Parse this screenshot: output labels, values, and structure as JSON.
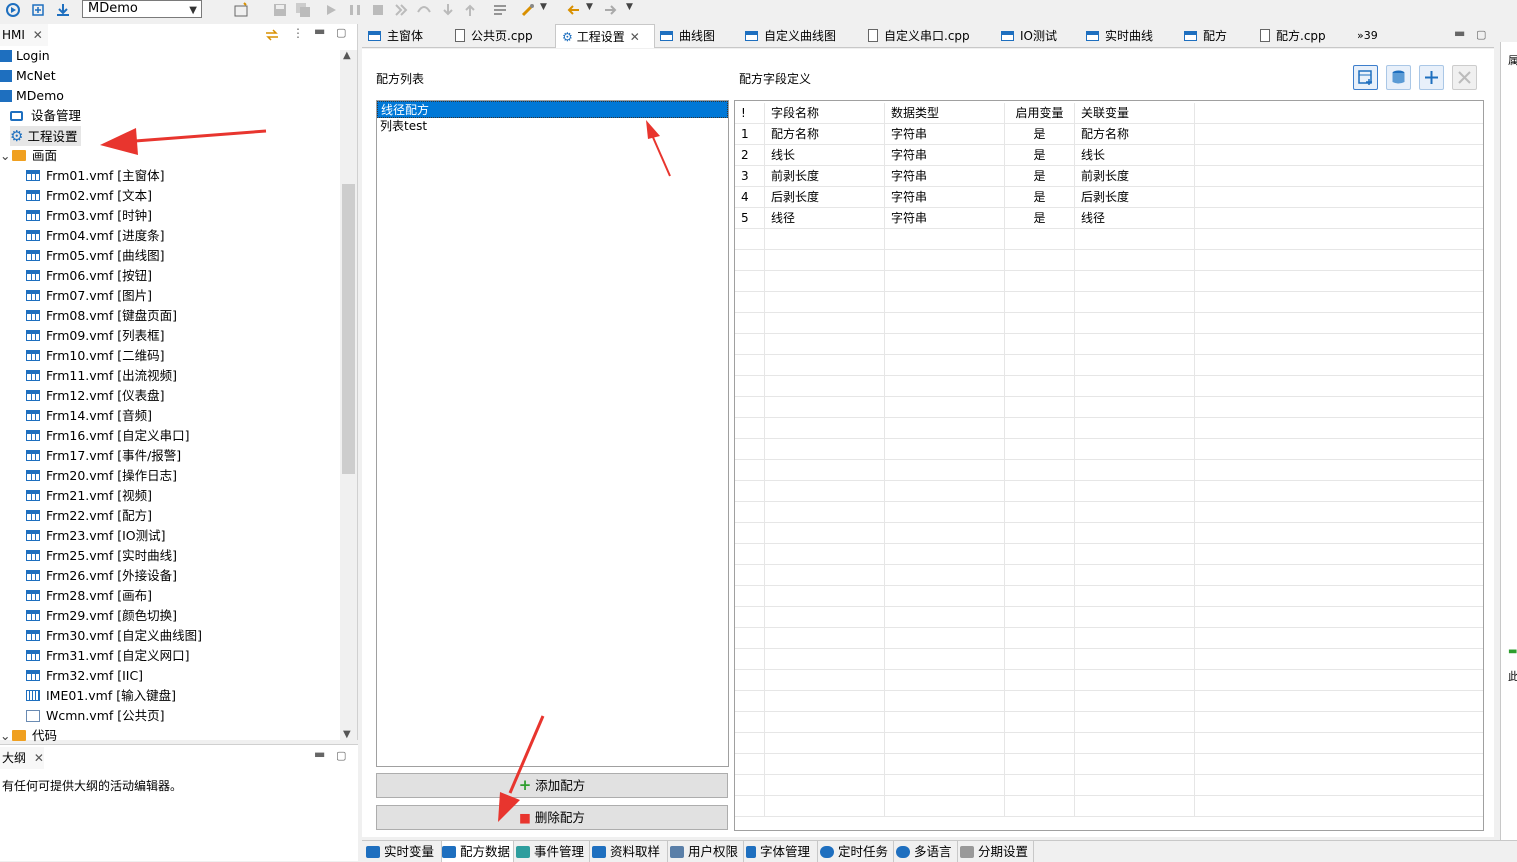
{
  "toolbar": {
    "project_combo": "MDemo",
    "icons": [
      "run-icon",
      "build-icon",
      "download-icon",
      "new-icon",
      "save-icon",
      "save-all-icon",
      "play-icon",
      "pause-icon",
      "stop-icon",
      "step-icon",
      "undo-icon",
      "redo-icon",
      "back-icon",
      "forward-icon"
    ]
  },
  "hmi_panel": {
    "title": "HMI",
    "tree": [
      {
        "label": "Login",
        "icon": "square-icon"
      },
      {
        "label": "McNet",
        "icon": "square-icon"
      },
      {
        "label": "MDemo",
        "icon": "square-icon"
      },
      {
        "label": "设备管理",
        "icon": "monitor-icon"
      },
      {
        "label": "工程设置",
        "icon": "gear-icon"
      },
      {
        "label": "画面",
        "icon": "folder-icon"
      },
      {
        "label": "Frm01.vmf [主窗体]",
        "icon": "screen-icon"
      },
      {
        "label": "Frm02.vmf [文本]",
        "icon": "screen-icon"
      },
      {
        "label": "Frm03.vmf [时钟]",
        "icon": "screen-icon"
      },
      {
        "label": "Frm04.vmf [进度条]",
        "icon": "screen-icon"
      },
      {
        "label": "Frm05.vmf [曲线图]",
        "icon": "screen-icon"
      },
      {
        "label": "Frm06.vmf [按钮]",
        "icon": "screen-icon"
      },
      {
        "label": "Frm07.vmf [图片]",
        "icon": "screen-icon"
      },
      {
        "label": "Frm08.vmf [键盘页面]",
        "icon": "screen-icon"
      },
      {
        "label": "Frm09.vmf [列表框]",
        "icon": "screen-icon"
      },
      {
        "label": "Frm10.vmf [二维码]",
        "icon": "screen-icon"
      },
      {
        "label": "Frm11.vmf [出流视频]",
        "icon": "screen-icon"
      },
      {
        "label": "Frm12.vmf [仪表盘]",
        "icon": "screen-icon"
      },
      {
        "label": "Frm14.vmf [音频]",
        "icon": "screen-icon"
      },
      {
        "label": "Frm16.vmf [自定义串口]",
        "icon": "screen-icon"
      },
      {
        "label": "Frm17.vmf [事件/报警]",
        "icon": "screen-icon"
      },
      {
        "label": "Frm20.vmf [操作日志]",
        "icon": "screen-icon"
      },
      {
        "label": "Frm21.vmf [视频]",
        "icon": "screen-icon"
      },
      {
        "label": "Frm22.vmf [配方]",
        "icon": "screen-icon"
      },
      {
        "label": "Frm23.vmf [IO测试]",
        "icon": "screen-icon"
      },
      {
        "label": "Frm25.vmf [实时曲线]",
        "icon": "screen-icon"
      },
      {
        "label": "Frm26.vmf [外接设备]",
        "icon": "screen-icon"
      },
      {
        "label": "Frm28.vmf [画布]",
        "icon": "screen-icon"
      },
      {
        "label": "Frm29.vmf [颜色切换]",
        "icon": "screen-icon"
      },
      {
        "label": "Frm30.vmf [自定义曲线图]",
        "icon": "screen-icon"
      },
      {
        "label": "Frm31.vmf [自定义网口]",
        "icon": "screen-icon"
      },
      {
        "label": "Frm32.vmf [IIC]",
        "icon": "screen-icon"
      },
      {
        "label": "IME01.vmf [输入键盘]",
        "icon": "keyboard-icon"
      },
      {
        "label": "Wcmn.vmf [公共页]",
        "icon": "blank-icon"
      },
      {
        "label": "代码",
        "icon": "folder-icon"
      }
    ]
  },
  "outline_panel": {
    "title": "大纲",
    "message": "有任何可提供大纲的活动编辑器。"
  },
  "editor_tabs": [
    {
      "label": "主窗体"
    },
    {
      "label": "公共页.cpp"
    },
    {
      "label": "工程设置"
    },
    {
      "label": "曲线图"
    },
    {
      "label": "自定义曲线图"
    },
    {
      "label": "自定义串口.cpp"
    },
    {
      "label": "IO测试"
    },
    {
      "label": "实时曲线"
    },
    {
      "label": "配方"
    },
    {
      "label": "配方.cpp"
    },
    {
      "label": "»39"
    }
  ],
  "editor": {
    "recipe_list_title": "配方列表",
    "recipe_list": [
      "线径配方",
      "列表test"
    ],
    "field_def_title": "配方字段定义",
    "add_button": "添加配方",
    "delete_button": "删除配方",
    "table": {
      "headers": [
        "!",
        "字段名称",
        "数据类型",
        "启用变量",
        "关联变量"
      ],
      "rows": [
        [
          "1",
          "配方名称",
          "字符串",
          "是",
          "配方名称"
        ],
        [
          "2",
          "线长",
          "字符串",
          "是",
          "线长"
        ],
        [
          "3",
          "前剥长度",
          "字符串",
          "是",
          "前剥长度"
        ],
        [
          "4",
          "后剥长度",
          "字符串",
          "是",
          "后剥长度"
        ],
        [
          "5",
          "线径",
          "字符串",
          "是",
          "线径"
        ]
      ]
    }
  },
  "right_strip": {
    "top_char": "属",
    "bottom_char": "此"
  },
  "bottom_tabs": [
    "实时变量",
    "配方数据",
    "事件管理",
    "资料取样",
    "用户权限",
    "字体管理",
    "定时任务",
    "多语言",
    "分期设置"
  ],
  "colors": {
    "accent": "#0078d7",
    "icon_blue": "#1e6fbf",
    "arrow_red": "#e8352e"
  }
}
